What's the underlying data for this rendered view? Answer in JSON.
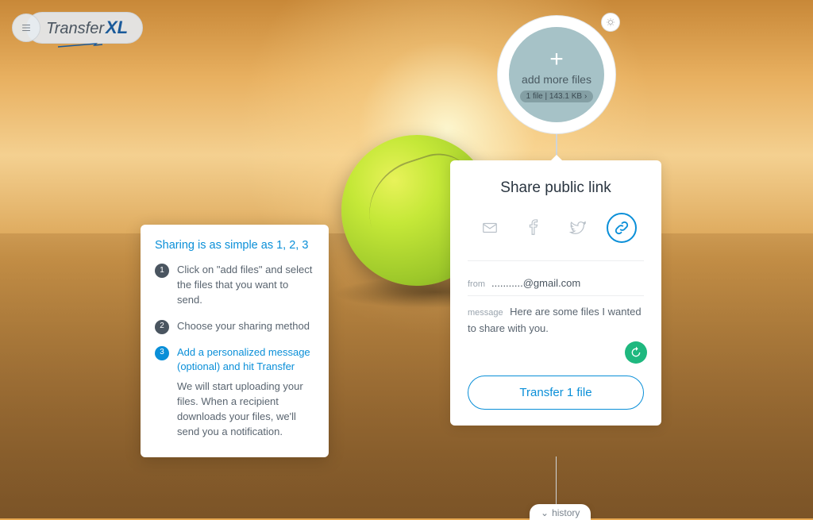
{
  "header": {
    "logo_text": "Transfer",
    "logo_suffix": "XL"
  },
  "add_circle": {
    "plus": "+",
    "label": "add more files",
    "file_summary": "1 file | 143.1 KB"
  },
  "share_card": {
    "title": "Share public link",
    "from_label": "from",
    "from_value": "...........@gmail.com",
    "message_label": "message",
    "message_value": "Here are some files I wanted to share with you.",
    "transfer_button": "Transfer 1 file"
  },
  "instructions": {
    "title": "Sharing is as simple as 1, 2, 3",
    "steps": [
      {
        "num": "1",
        "text": "Click on \"add files\" and select the files that you want to send.",
        "active": false
      },
      {
        "num": "2",
        "text": "Choose your sharing method",
        "active": false
      },
      {
        "num": "3",
        "text": "Add a personalized message (optional) and hit Transfer",
        "sub": "We will start uploading your files. When a recipient downloads your files, we'll send you a notification.",
        "active": true
      }
    ]
  },
  "history": {
    "label": "history"
  }
}
